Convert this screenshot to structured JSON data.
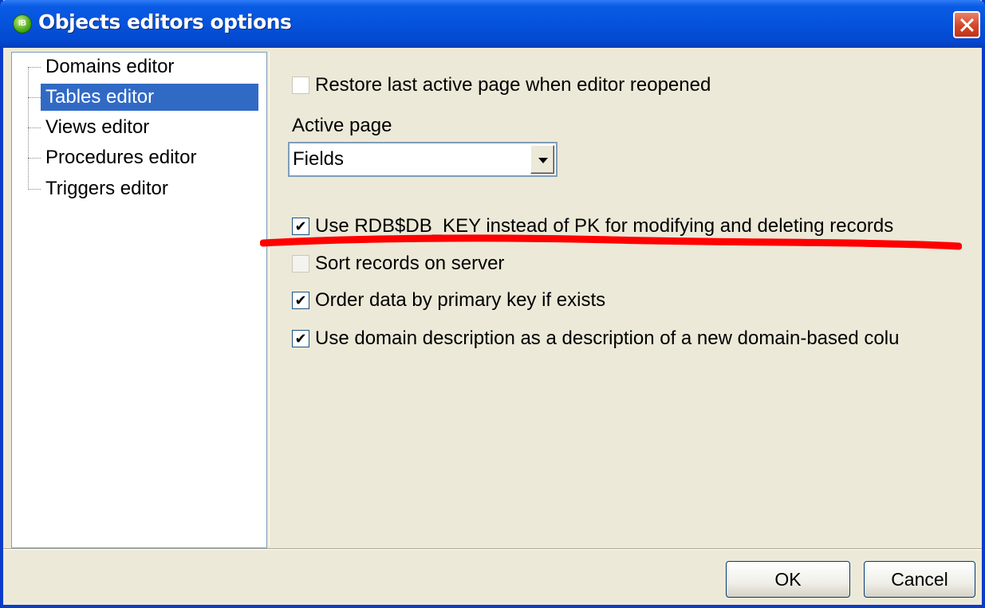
{
  "window": {
    "title": "Objects editors options",
    "icon_text": "IB"
  },
  "tree": {
    "items": [
      {
        "label": "Domains editor",
        "selected": false
      },
      {
        "label": "Tables editor",
        "selected": true
      },
      {
        "label": "Views editor",
        "selected": false
      },
      {
        "label": "Procedures editor",
        "selected": false
      },
      {
        "label": "Triggers editor",
        "selected": false
      }
    ]
  },
  "options": {
    "restore_last_page": {
      "label": "Restore last active page when editor reopened",
      "checked": false
    },
    "active_page": {
      "label": "Active page",
      "value": "Fields"
    },
    "use_rdb_key": {
      "label": "Use RDB$DB_KEY instead of PK for modifying and deleting records",
      "checked": true
    },
    "sort_on_server": {
      "label": "Sort records on server",
      "checked": false
    },
    "order_by_pk": {
      "label": "Order data by primary key if exists",
      "checked": true
    },
    "use_domain_desc": {
      "label": "Use domain description as a description of a new domain-based colu",
      "checked": true
    }
  },
  "annotation": {
    "color": "#ff0000"
  },
  "buttons": {
    "ok": "OK",
    "cancel": "Cancel"
  },
  "colors": {
    "titlebar": "#0553dc",
    "selection": "#316ac5",
    "dialog_bg": "#ece9d8"
  }
}
